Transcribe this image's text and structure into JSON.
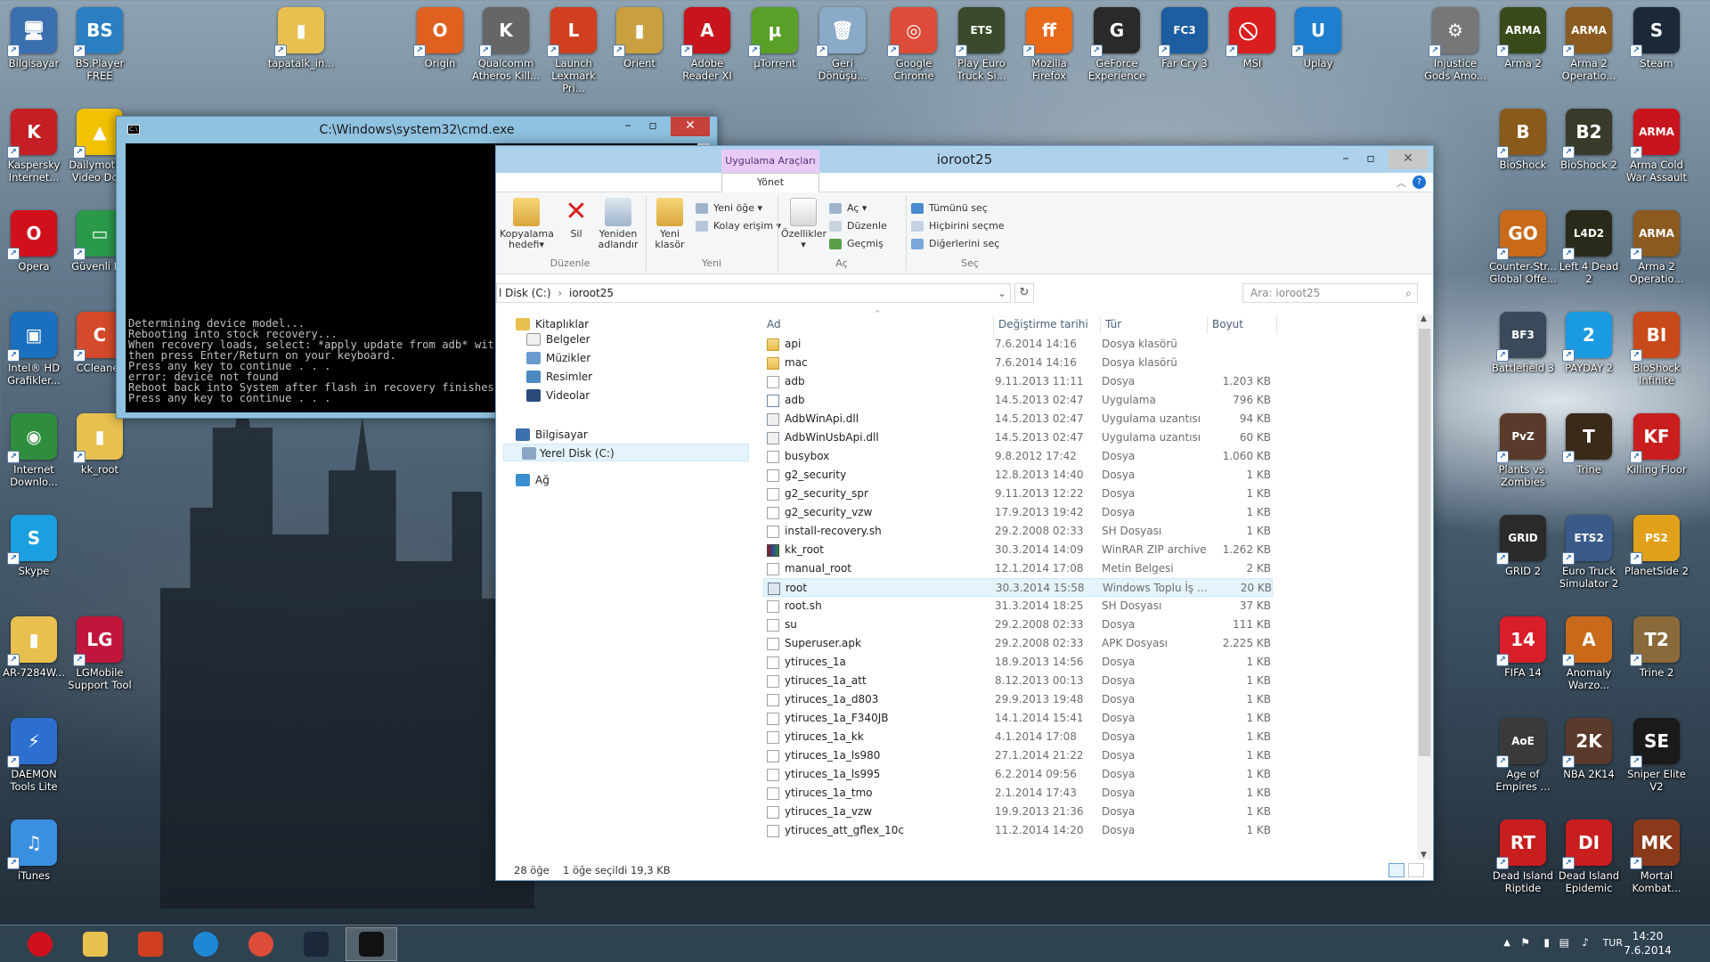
{
  "desktop": {
    "icons_left": [
      {
        "label": "Bilgisayar",
        "color": "#3a6fb0",
        "glyph": "🖥"
      },
      {
        "label": "BS.Player FREE",
        "color": "#2a7fc0",
        "glyph": "BS"
      },
      {
        "label": "Kaspersky Internet...",
        "color": "#c41f24",
        "glyph": "K"
      },
      {
        "label": "Dailymotion Video Do...",
        "color": "#f2c200",
        "glyph": "▲"
      },
      {
        "label": "Opera",
        "color": "#d0101a",
        "glyph": "O"
      },
      {
        "label": "Güvenli P...",
        "color": "#2a9a4a",
        "glyph": "▭"
      },
      {
        "label": "Intel® HD Grafikler...",
        "color": "#1b6fbf",
        "glyph": "▣"
      },
      {
        "label": "CCleaner",
        "color": "#d54a2a",
        "glyph": "C"
      },
      {
        "label": "Internet Downlo...",
        "color": "#2e8e3e",
        "glyph": "◉"
      },
      {
        "label": "kk_root",
        "color": "#e8c050",
        "glyph": "▮"
      },
      {
        "label": "Skype",
        "color": "#1a9fe0",
        "glyph": "S"
      },
      {
        "label": "AR-7284W...",
        "color": "#e8c050",
        "glyph": "▮"
      },
      {
        "label": "LGMobile Support Tool",
        "color": "#c0163c",
        "glyph": "LG"
      },
      {
        "label": "DAEMON Tools Lite",
        "color": "#2d6fd0",
        "glyph": "⚡"
      },
      {
        "label": "iTunes",
        "color": "#3a8fe0",
        "glyph": "♫"
      }
    ],
    "icons_top": [
      {
        "label": "tapatalk_in...",
        "color": "#e8c050",
        "glyph": "▮"
      },
      {
        "label": "Origin",
        "color": "#e06020",
        "glyph": "O"
      },
      {
        "label": "Qualcomm Atheros Kill...",
        "color": "#666",
        "glyph": "K"
      },
      {
        "label": "Launch Lexmark Pri...",
        "color": "#d04020",
        "glyph": "L"
      },
      {
        "label": "Orient",
        "color": "#c8a040",
        "glyph": "▮"
      },
      {
        "label": "Adobe Reader XI",
        "color": "#c8141c",
        "glyph": "A"
      },
      {
        "label": "µTorrent",
        "color": "#5aa028",
        "glyph": "µ"
      },
      {
        "label": "Geri Dönüşü...",
        "color": "#8aaac8",
        "glyph": "🗑"
      },
      {
        "label": "Google Chrome",
        "color": "#dd4b39",
        "glyph": "◎"
      },
      {
        "label": "Play Euro Truck Si...",
        "color": "#3a4a2a",
        "glyph": "ETS"
      },
      {
        "label": "Mozilla Firefox",
        "color": "#e66a1a",
        "glyph": "ff"
      },
      {
        "label": "GeForce Experience",
        "color": "#2a2a2a",
        "glyph": "G"
      },
      {
        "label": "Far Cry 3",
        "color": "#1d5da0",
        "glyph": "FC3"
      },
      {
        "label": "MSI",
        "color": "#d81e1e",
        "glyph": "⃠"
      },
      {
        "label": "Uplay",
        "color": "#1e7fd0",
        "glyph": "U"
      }
    ],
    "icons_right": [
      {
        "label": "Injustice Gods Amo...",
        "color": "#777",
        "glyph": "⚙"
      },
      {
        "label": "Arma 2",
        "color": "#3a4a1a",
        "glyph": "ARMA"
      },
      {
        "label": "Arma 2 Operatio...",
        "color": "#8a5a20",
        "glyph": "ARMA"
      },
      {
        "label": "Steam",
        "color": "#1b2838",
        "glyph": "S"
      },
      {
        "label": "BioShock",
        "color": "#8a5a1a",
        "glyph": "B"
      },
      {
        "label": "BioShock 2",
        "color": "#3a3a2a",
        "glyph": "B2"
      },
      {
        "label": "Arma Cold War Assault",
        "color": "#c8141c",
        "glyph": "ARMA"
      },
      {
        "label": "Counter-Str... Global Offe...",
        "color": "#c86a1a",
        "glyph": "GO"
      },
      {
        "label": "Left 4 Dead 2",
        "color": "#2a2a1a",
        "glyph": "L4D2"
      },
      {
        "label": "Arma 2 Operatio...",
        "color": "#8a5a20",
        "glyph": "ARMA"
      },
      {
        "label": "Battlefield 3",
        "color": "#3a4a5a",
        "glyph": "BF3"
      },
      {
        "label": "PAYDAY 2",
        "color": "#1a9ae0",
        "glyph": "2"
      },
      {
        "label": "BioShock Infinite",
        "color": "#c84a1a",
        "glyph": "BI"
      },
      {
        "label": "Plants vs. Zombies",
        "color": "#5a3a2a",
        "glyph": "PvZ"
      },
      {
        "label": "Trine",
        "color": "#3a2a1a",
        "glyph": "T"
      },
      {
        "label": "Killing Floor",
        "color": "#c81e1e",
        "glyph": "KF"
      },
      {
        "label": "GRID 2",
        "color": "#2a2a2a",
        "glyph": "GRID"
      },
      {
        "label": "Euro Truck Simulator 2",
        "color": "#3a5a8a",
        "glyph": "ETS2"
      },
      {
        "label": "PlanetSide 2",
        "color": "#e0a01a",
        "glyph": "PS2"
      },
      {
        "label": "FIFA 14",
        "color": "#d81e2a",
        "glyph": "14"
      },
      {
        "label": "Anomaly Warzo...",
        "color": "#c86a1a",
        "glyph": "A"
      },
      {
        "label": "Trine 2",
        "color": "#8a6a3a",
        "glyph": "T2"
      },
      {
        "label": "Age of Empires ...",
        "color": "#3a3a3a",
        "glyph": "AoE"
      },
      {
        "label": "NBA 2K14",
        "color": "#5a3a2a",
        "glyph": "2K"
      },
      {
        "label": "Sniper Elite V2",
        "color": "#1a1a1a",
        "glyph": "SE"
      },
      {
        "label": "Dead Island Riptide",
        "color": "#c81e1e",
        "glyph": "RT"
      },
      {
        "label": "Dead Island Epidemic",
        "color": "#c81e1e",
        "glyph": "DI"
      },
      {
        "label": "Mortal Kombat...",
        "color": "#8a3a1a",
        "glyph": "MK"
      }
    ]
  },
  "cmd": {
    "title": "C:\\Windows\\system32\\cmd.exe",
    "icon": "C:\\",
    "output": "Determining device model...\nRebooting into stock recovery...\nWhen recovery loads, select: *apply update from adb* with power button...\nthen press Enter/Return on your keyboard.\nPress any key to continue . . .\nerror: device not found\nReboot back into System after flash in recovery finishes.\nPress any key to continue . . ."
  },
  "explorer": {
    "title": "ioroot25",
    "context_tab": "Uygulama Araçları",
    "manage_tab": "Yönet",
    "ribbon": {
      "copy_to": "Kopyalama hedefi",
      "delete": "Sil",
      "rename": "Yeniden adlandır",
      "new_folder": "Yeni klasör",
      "new_item": "Yeni öğe",
      "easy_access": "Kolay erişim",
      "properties": "Özellikler",
      "open": "Aç",
      "edit": "Düzenle",
      "history": "Geçmiş",
      "select_all": "Tümünü seç",
      "select_none": "Hiçbirini seçme",
      "invert": "Diğerlerini seç",
      "group_organize": "Düzenle",
      "group_new": "Yeni",
      "group_open": "Aç",
      "group_select": "Seç"
    },
    "address": {
      "part1": "l Disk (C:)",
      "part2": "ioroot25"
    },
    "search_placeholder": "Ara: ioroot25",
    "nav": {
      "libraries": "Kitaplıklar",
      "docs": "Belgeler",
      "music": "Müzikler",
      "pictures": "Resimler",
      "videos": "Videolar",
      "computer": "Bilgisayar",
      "local_disk": "Yerel Disk (C:)",
      "network": "Ağ"
    },
    "columns": {
      "name": "Ad",
      "modified": "Değiştirme tarihi",
      "type": "Tür",
      "size": "Boyut"
    },
    "files": [
      {
        "name": "api",
        "date": "7.6.2014 14:16",
        "type": "Dosya klasörü",
        "size": "",
        "kind": "fold"
      },
      {
        "name": "mac",
        "date": "7.6.2014 14:16",
        "type": "Dosya klasörü",
        "size": "",
        "kind": "fold"
      },
      {
        "name": "adb",
        "date": "9.11.2013 11:11",
        "type": "Dosya",
        "size": "1.203 KB",
        "kind": "file"
      },
      {
        "name": "adb",
        "date": "14.5.2013 02:47",
        "type": "Uygulama",
        "size": "796 KB",
        "kind": "exe"
      },
      {
        "name": "AdbWinApi.dll",
        "date": "14.5.2013 02:47",
        "type": "Uygulama uzantısı",
        "size": "94 KB",
        "kind": "dll"
      },
      {
        "name": "AdbWinUsbApi.dll",
        "date": "14.5.2013 02:47",
        "type": "Uygulama uzantısı",
        "size": "60 KB",
        "kind": "dll"
      },
      {
        "name": "busybox",
        "date": "9.8.2012 17:42",
        "type": "Dosya",
        "size": "1.060 KB",
        "kind": "file"
      },
      {
        "name": "g2_security",
        "date": "12.8.2013 14:40",
        "type": "Dosya",
        "size": "1 KB",
        "kind": "file"
      },
      {
        "name": "g2_security_spr",
        "date": "9.11.2013 12:22",
        "type": "Dosya",
        "size": "1 KB",
        "kind": "file"
      },
      {
        "name": "g2_security_vzw",
        "date": "17.9.2013 19:42",
        "type": "Dosya",
        "size": "1 KB",
        "kind": "file"
      },
      {
        "name": "install-recovery.sh",
        "date": "29.2.2008 02:33",
        "type": "SH Dosyası",
        "size": "1 KB",
        "kind": "file"
      },
      {
        "name": "kk_root",
        "date": "30.3.2014 14:09",
        "type": "WinRAR ZIP archive",
        "size": "1.262 KB",
        "kind": "zip"
      },
      {
        "name": "manual_root",
        "date": "12.1.2014 17:08",
        "type": "Metin Belgesi",
        "size": "2 KB",
        "kind": "file"
      },
      {
        "name": "root",
        "date": "30.3.2014 15:58",
        "type": "Windows Toplu İş ...",
        "size": "20 KB",
        "kind": "bat"
      },
      {
        "name": "root.sh",
        "date": "31.3.2014 18:25",
        "type": "SH Dosyası",
        "size": "37 KB",
        "kind": "file"
      },
      {
        "name": "su",
        "date": "29.2.2008 02:33",
        "type": "Dosya",
        "size": "111 KB",
        "kind": "file"
      },
      {
        "name": "Superuser.apk",
        "date": "29.2.2008 02:33",
        "type": "APK Dosyası",
        "size": "2.225 KB",
        "kind": "file"
      },
      {
        "name": "ytiruces_1a",
        "date": "18.9.2013 14:56",
        "type": "Dosya",
        "size": "1 KB",
        "kind": "file"
      },
      {
        "name": "ytiruces_1a_att",
        "date": "8.12.2013 00:13",
        "type": "Dosya",
        "size": "1 KB",
        "kind": "file"
      },
      {
        "name": "ytiruces_1a_d803",
        "date": "29.9.2013 19:48",
        "type": "Dosya",
        "size": "1 KB",
        "kind": "file"
      },
      {
        "name": "ytiruces_1a_F340JB",
        "date": "14.1.2014 15:41",
        "type": "Dosya",
        "size": "1 KB",
        "kind": "file"
      },
      {
        "name": "ytiruces_1a_kk",
        "date": "4.1.2014 17:08",
        "type": "Dosya",
        "size": "1 KB",
        "kind": "file"
      },
      {
        "name": "ytiruces_1a_ls980",
        "date": "27.1.2014 21:22",
        "type": "Dosya",
        "size": "1 KB",
        "kind": "file"
      },
      {
        "name": "ytiruces_1a_ls995",
        "date": "6.2.2014 09:56",
        "type": "Dosya",
        "size": "1 KB",
        "kind": "file"
      },
      {
        "name": "ytiruces_1a_tmo",
        "date": "2.1.2014 17:43",
        "type": "Dosya",
        "size": "1 KB",
        "kind": "file"
      },
      {
        "name": "ytiruces_1a_vzw",
        "date": "19.9.2013 21:36",
        "type": "Dosya",
        "size": "1 KB",
        "kind": "file"
      },
      {
        "name": "ytiruces_att_gflex_10c",
        "date": "11.2.2014 14:20",
        "type": "Dosya",
        "size": "1 KB",
        "kind": "file"
      }
    ],
    "selected_file": "root",
    "status": {
      "count": "28 öğe",
      "selection": "1 öğe seçildi  19,3 KB"
    }
  },
  "taskbar": {
    "apps": [
      {
        "name": "opera",
        "color": "#d0101a"
      },
      {
        "name": "file-explorer",
        "color": "#e8c050"
      },
      {
        "name": "office-app",
        "color": "#d04020"
      },
      {
        "name": "internet-explorer",
        "color": "#1e88d8"
      },
      {
        "name": "chrome",
        "color": "#dd4b39"
      },
      {
        "name": "steam",
        "color": "#1b2838"
      },
      {
        "name": "cmd",
        "color": "#111111"
      }
    ],
    "lang": "TUR",
    "time": "14:20",
    "date": "7.6.2014"
  }
}
